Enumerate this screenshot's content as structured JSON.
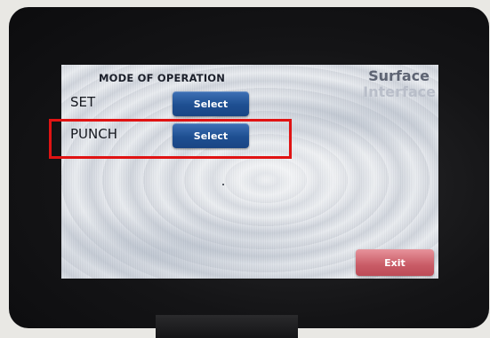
{
  "panel": {
    "mode_title": "MODE OF OPERATION",
    "rows": [
      {
        "label": "SET",
        "button": "Select"
      },
      {
        "label": "PUNCH",
        "button": "Select"
      }
    ],
    "brand_line1": "Surface",
    "brand_line2": "Interface",
    "exit_label": "Exit"
  },
  "colors": {
    "select_button": "#1e4f91",
    "exit_button": "#c95b66",
    "highlight": "#e01313"
  }
}
